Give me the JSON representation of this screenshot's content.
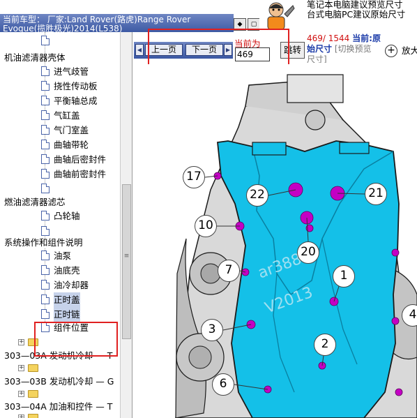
{
  "header": {
    "vehicle_label": "当前车型： 厂家:Land Rover(路虎)Range Rover",
    "vehicle_label_line2": "Evoque(揽胜极光)2014(L538)",
    "notice_line1": "笔记本电脑建议预览尺寸",
    "notice_line2": "台式电脑PC建议原始尺寸"
  },
  "tree": {
    "items": [
      {
        "type": "leaf",
        "label": ""
      },
      {
        "type": "group",
        "label": "机油滤清器壳体"
      },
      {
        "type": "leaf",
        "label": "进气歧管"
      },
      {
        "type": "leaf",
        "label": "挠性传动板"
      },
      {
        "type": "leaf",
        "label": "平衡轴总成"
      },
      {
        "type": "leaf",
        "label": "气缸盖"
      },
      {
        "type": "leaf",
        "label": "气门室盖"
      },
      {
        "type": "leaf",
        "label": "曲轴带轮"
      },
      {
        "type": "leaf",
        "label": "曲轴后密封件"
      },
      {
        "type": "leaf",
        "label": "曲轴前密封件"
      },
      {
        "type": "leaf",
        "label": ""
      },
      {
        "type": "group",
        "label": "燃油滤清器滤芯"
      },
      {
        "type": "leaf",
        "label": "凸轮轴"
      },
      {
        "type": "leaf",
        "label": ""
      },
      {
        "type": "group",
        "label": "系统操作和组件说明"
      },
      {
        "type": "leaf",
        "label": "油泵"
      },
      {
        "type": "leaf",
        "label": "油底壳"
      },
      {
        "type": "leaf",
        "label": "油冷却器"
      },
      {
        "type": "leaf",
        "label": "正时盖",
        "selected": true
      },
      {
        "type": "leaf",
        "label": "正时链",
        "selected": true
      },
      {
        "type": "leaf",
        "label": "组件位置"
      },
      {
        "type": "folder",
        "label": ""
      },
      {
        "type": "folder-root",
        "label": "303—03A 发动机冷却 — T"
      },
      {
        "type": "folder",
        "label": ""
      },
      {
        "type": "folder-root",
        "label": "303—03B 发动机冷却 — G"
      },
      {
        "type": "folder",
        "label": ""
      },
      {
        "type": "folder-root",
        "label": "303—04A 加油和控件 — T"
      },
      {
        "type": "folder",
        "label": ""
      }
    ]
  },
  "toolbar": {
    "prev_label": "上一页",
    "next_label": "下一页",
    "current_label": "当前为",
    "page_value": "469",
    "jump_label": "跳转",
    "page_counter": "469/ 1544",
    "current_caption": "当前:原",
    "size_caption": "始尺寸",
    "switch_preview": "[切换预览",
    "size_suffix": "尺寸]",
    "zoom_label": "放大"
  },
  "diagram": {
    "callouts": [
      "17",
      "22",
      "21",
      "10",
      "20",
      "7",
      "1",
      "3",
      "2",
      "6",
      "4"
    ],
    "colors": {
      "cover": "#14c0e8",
      "bolt": "#c400c4",
      "outline": "#1a1a1a",
      "engine_gray": "#b8b8b8",
      "highlight_box": "#e02020"
    }
  }
}
